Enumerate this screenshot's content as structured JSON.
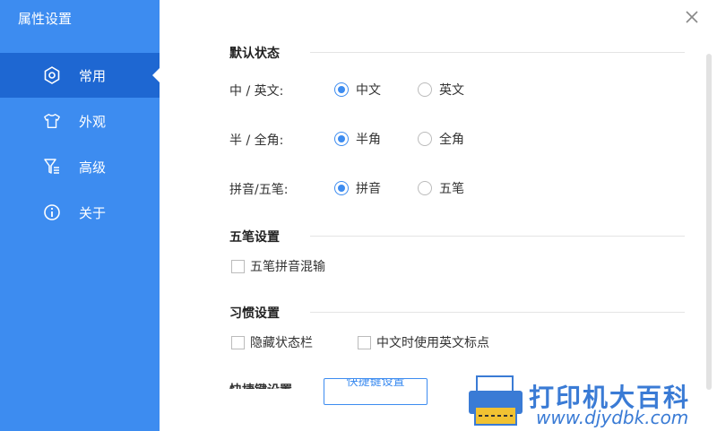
{
  "sidebar": {
    "title": "属性设置",
    "items": [
      {
        "label": "常用",
        "icon": "gear-icon",
        "active": true
      },
      {
        "label": "外观",
        "icon": "tshirt-icon",
        "active": false
      },
      {
        "label": "高级",
        "icon": "filter-icon",
        "active": false
      },
      {
        "label": "关于",
        "icon": "info-icon",
        "active": false
      }
    ]
  },
  "colors": {
    "accent": "#3d8cf0",
    "sidebar_active": "#1e67d2",
    "sidebar_bg": "#3d8cf0"
  },
  "sections": {
    "default_state": {
      "title": "默认状态",
      "rows": [
        {
          "label": "中 / 英文:",
          "options": [
            "中文",
            "英文"
          ],
          "selected": "中文"
        },
        {
          "label": "半 / 全角:",
          "options": [
            "半角",
            "全角"
          ],
          "selected": "半角"
        },
        {
          "label": "拼音/五笔:",
          "options": [
            "拼音",
            "五笔"
          ],
          "selected": "拼音"
        }
      ]
    },
    "wubi": {
      "title": "五笔设置",
      "checkboxes": [
        {
          "label": "五笔拼音混输",
          "checked": false
        }
      ]
    },
    "habit": {
      "title": "习惯设置",
      "checkboxes": [
        {
          "label": "隐藏状态栏",
          "checked": false
        },
        {
          "label": "中文时使用英文标点",
          "checked": false
        }
      ]
    },
    "partial": {
      "label": "快捷键设置",
      "button": "快捷键设置"
    }
  },
  "watermark": {
    "text": "打印机大百科",
    "url": "www.djydbk.com"
  }
}
